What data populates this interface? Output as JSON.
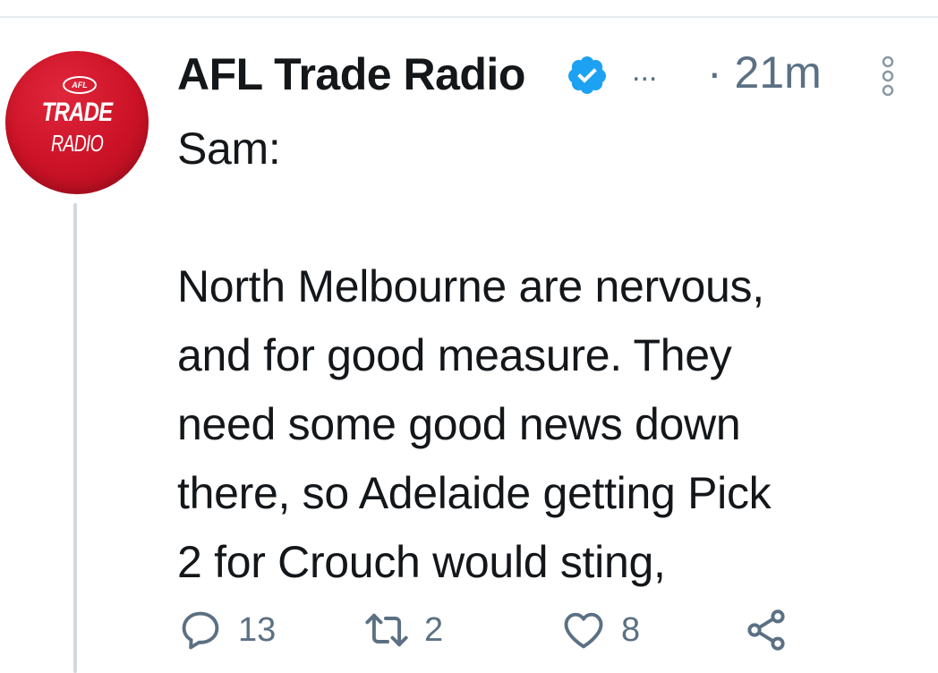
{
  "tweet": {
    "avatar": {
      "logo_text_top": "AFL",
      "logo_text_main": "TRADE",
      "logo_text_sub": "RADIO",
      "background_color": "#cc1226"
    },
    "display_name": "AFL Trade Radio",
    "truncation": "...",
    "timestamp": "· 21m",
    "body_lines": [
      "Sam:",
      "",
      "North Melbourne are nervous,",
      "and for good measure. They",
      "need some good news down",
      "there, so Adelaide getting Pick",
      "2 for Crouch would sting,"
    ],
    "actions": {
      "reply_count": "13",
      "retweet_count": "2",
      "like_count": "8"
    },
    "icons": {
      "verified": "verified-badge-icon",
      "more": "more-vertical-icon",
      "reply": "reply-icon",
      "retweet": "retweet-icon",
      "like": "heart-icon",
      "share": "share-icon"
    },
    "colors": {
      "verified": "#1da1f2",
      "secondary_text": "#5b7083",
      "thread_line": "#cfd9de"
    }
  }
}
